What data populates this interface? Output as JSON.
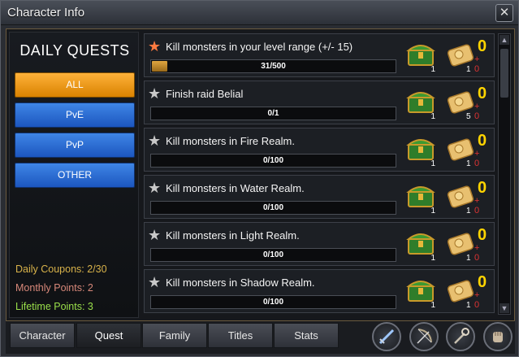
{
  "window": {
    "title": "Character Info",
    "close_symbol": "✕"
  },
  "left_panel": {
    "heading": "DAILY QUESTS",
    "filters": [
      {
        "label": "ALL",
        "active": true
      },
      {
        "label": "PvE",
        "active": false
      },
      {
        "label": "PvP",
        "active": false
      },
      {
        "label": "OTHER",
        "active": false
      }
    ],
    "stats": {
      "daily_coupons": "Daily Coupons: 2/30",
      "monthly_points": "Monthly Points: 2",
      "lifetime_points": "Lifetime Points: 3"
    },
    "stat_colors": {
      "daily": "#d8b24a",
      "monthly": "#d8887a",
      "lifetime": "#9adf4a"
    }
  },
  "quests": [
    {
      "title": "Kill monsters in your level range (+/- 15)",
      "progress": "31/500",
      "fraction": 0.062,
      "star": "orange",
      "chest_count": "1",
      "ticket_count": "1",
      "plus": "+ 0",
      "points": "0"
    },
    {
      "title": "Finish raid Belial",
      "progress": "0/1",
      "fraction": 0,
      "star": "gray",
      "chest_count": "1",
      "ticket_count": "5",
      "plus": "+ 0",
      "points": "0"
    },
    {
      "title": "Kill monsters in Fire Realm.",
      "progress": "0/100",
      "fraction": 0,
      "star": "gray",
      "chest_count": "1",
      "ticket_count": "1",
      "plus": "+ 0",
      "points": "0"
    },
    {
      "title": "Kill monsters in Water Realm.",
      "progress": "0/100",
      "fraction": 0,
      "star": "gray",
      "chest_count": "1",
      "ticket_count": "1",
      "plus": "+ 0",
      "points": "0"
    },
    {
      "title": "Kill monsters in Light Realm.",
      "progress": "0/100",
      "fraction": 0,
      "star": "gray",
      "chest_count": "1",
      "ticket_count": "1",
      "plus": "+ 0",
      "points": "0"
    },
    {
      "title": "Kill monsters in Shadow Realm.",
      "progress": "0/100",
      "fraction": 0,
      "star": "gray",
      "chest_count": "1",
      "ticket_count": "1",
      "plus": "+ 0",
      "points": "0"
    }
  ],
  "tabs": [
    {
      "label": "Character",
      "active": false
    },
    {
      "label": "Quest",
      "active": true
    },
    {
      "label": "Family",
      "active": false
    },
    {
      "label": "Titles",
      "active": false
    },
    {
      "label": "Stats",
      "active": false
    }
  ],
  "action_icons": [
    "sword-icon",
    "bow-icon",
    "staff-icon",
    "fist-icon"
  ],
  "colors": {
    "accent_orange": "#f0a020",
    "filter_blue": "#2a6fd8",
    "reward_gold": "#ffd400",
    "reward_red": "#dd3333"
  }
}
